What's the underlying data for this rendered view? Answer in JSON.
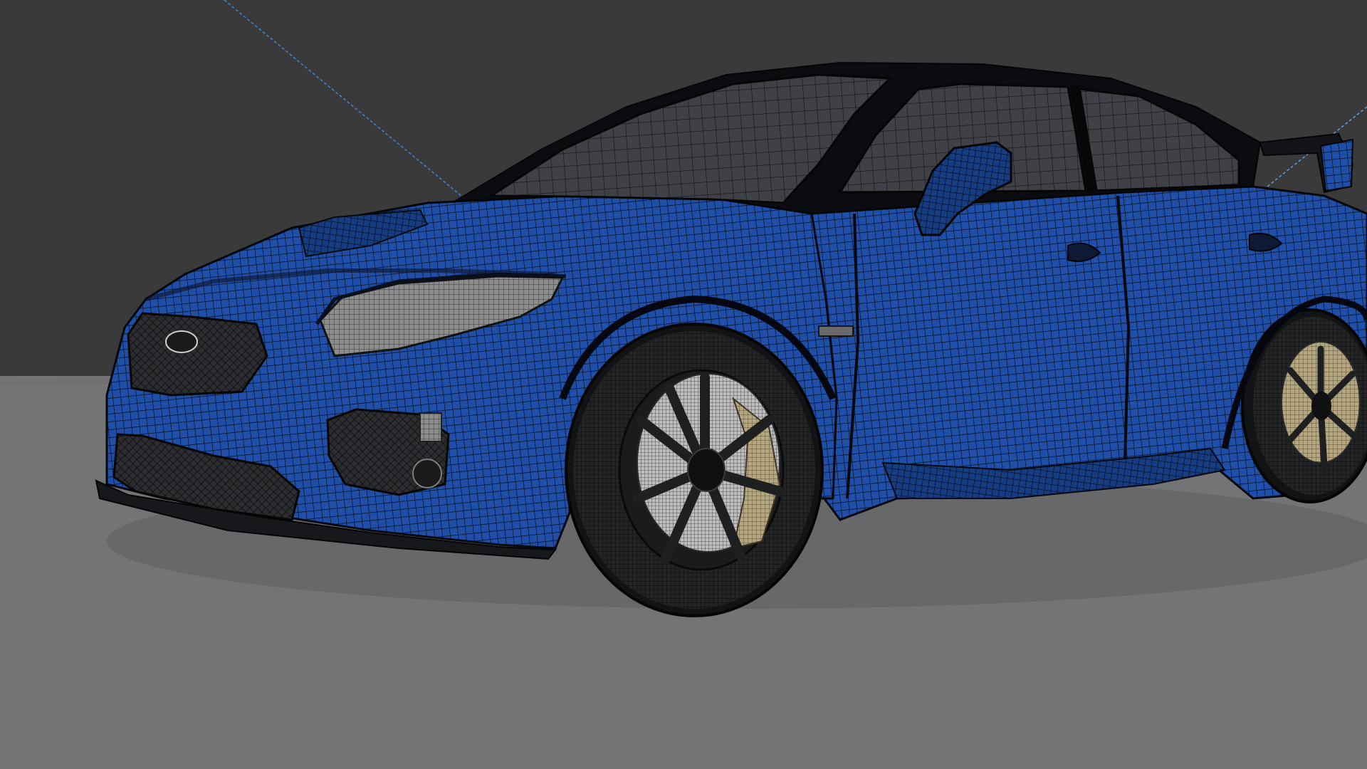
{
  "scene": {
    "view": "3d-viewport-wireframe-overlay",
    "subject": "sports-sedan-mesh",
    "colors": {
      "background": "#3a3a3a",
      "floor": "#737475",
      "body_paint": "#1f4fa8",
      "body_shadow": "#0f2a63",
      "wire": "#0a0f1c",
      "glass": "#3e4045",
      "tire": "#1c1d1f",
      "rim": "#2a2a2c",
      "brake_caliper": "#b8a77c",
      "light_guide": "#3d86d6",
      "headlight": "#8e8e8e"
    },
    "icons": [
      "light-guide-line",
      "car-mesh"
    ]
  }
}
